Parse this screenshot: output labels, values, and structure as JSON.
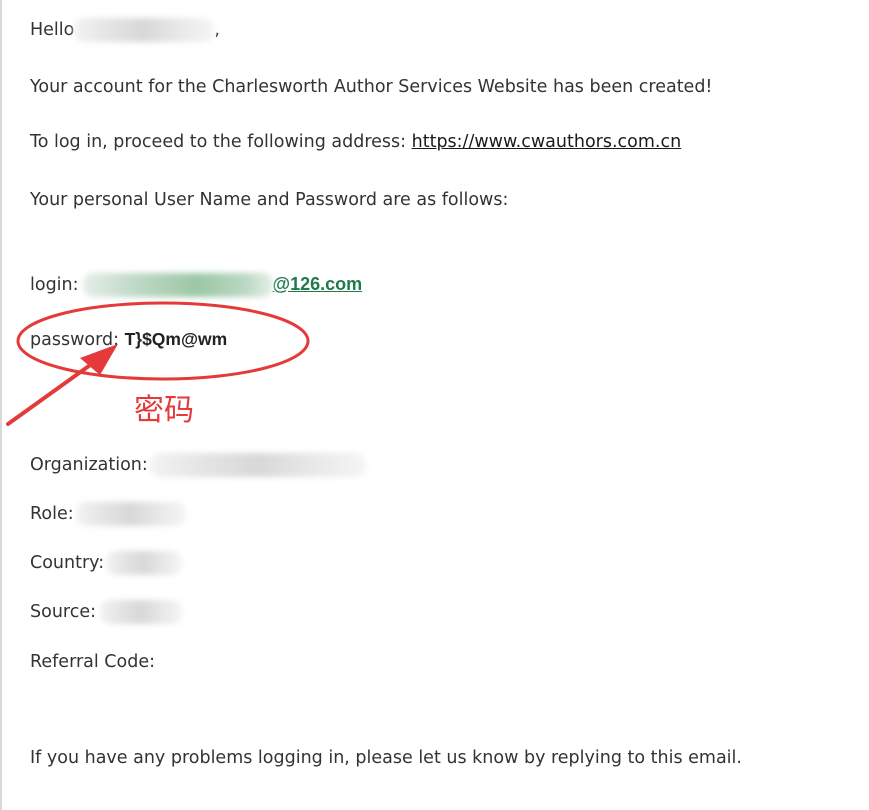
{
  "email": {
    "greeting": "Hello",
    "greeting_end": ",",
    "account_created": "Your account for the Charlesworth Author Services Website has been created!",
    "login_prefix": "To log in, proceed to the following address: ",
    "login_url": "https://www.cwauthors.com.cn",
    "credentials_intro": "Your personal User Name and Password are as follows:",
    "login_label": "login:",
    "login_email_suffix": "@126.com",
    "password_label": "password:",
    "password_value": "T}$Qm@wm",
    "organization_label": "Organization:",
    "role_label": "Role:",
    "country_label": "Country:",
    "source_label": "Source:",
    "referral_label": "Referral Code:",
    "problems_text": "If you have any problems logging in, please let us know by replying to this email."
  },
  "annotation": {
    "text": "密码",
    "color": "#e53a3a"
  }
}
